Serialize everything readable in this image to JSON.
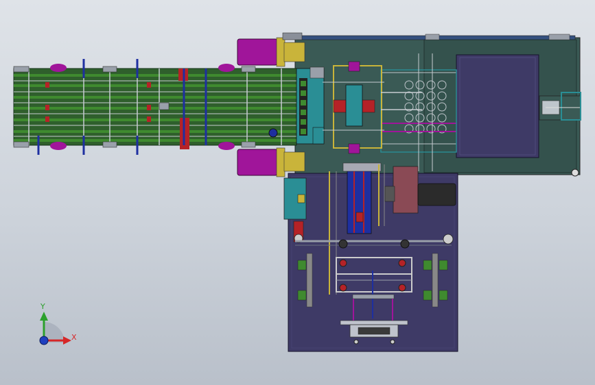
{
  "triad": {
    "y_label": "Y",
    "x_label": "X"
  },
  "colors": {
    "frame_green": "#2f5f2c",
    "rail_green": "#3f8a2f",
    "plate_dark": "#3e3a66",
    "plate_teal": "#3a5a55",
    "magenta": "#a0159a",
    "yellow": "#c9b43a",
    "red": "#b52227",
    "blue": "#1e2fa0",
    "cyan": "#2a8e95"
  }
}
